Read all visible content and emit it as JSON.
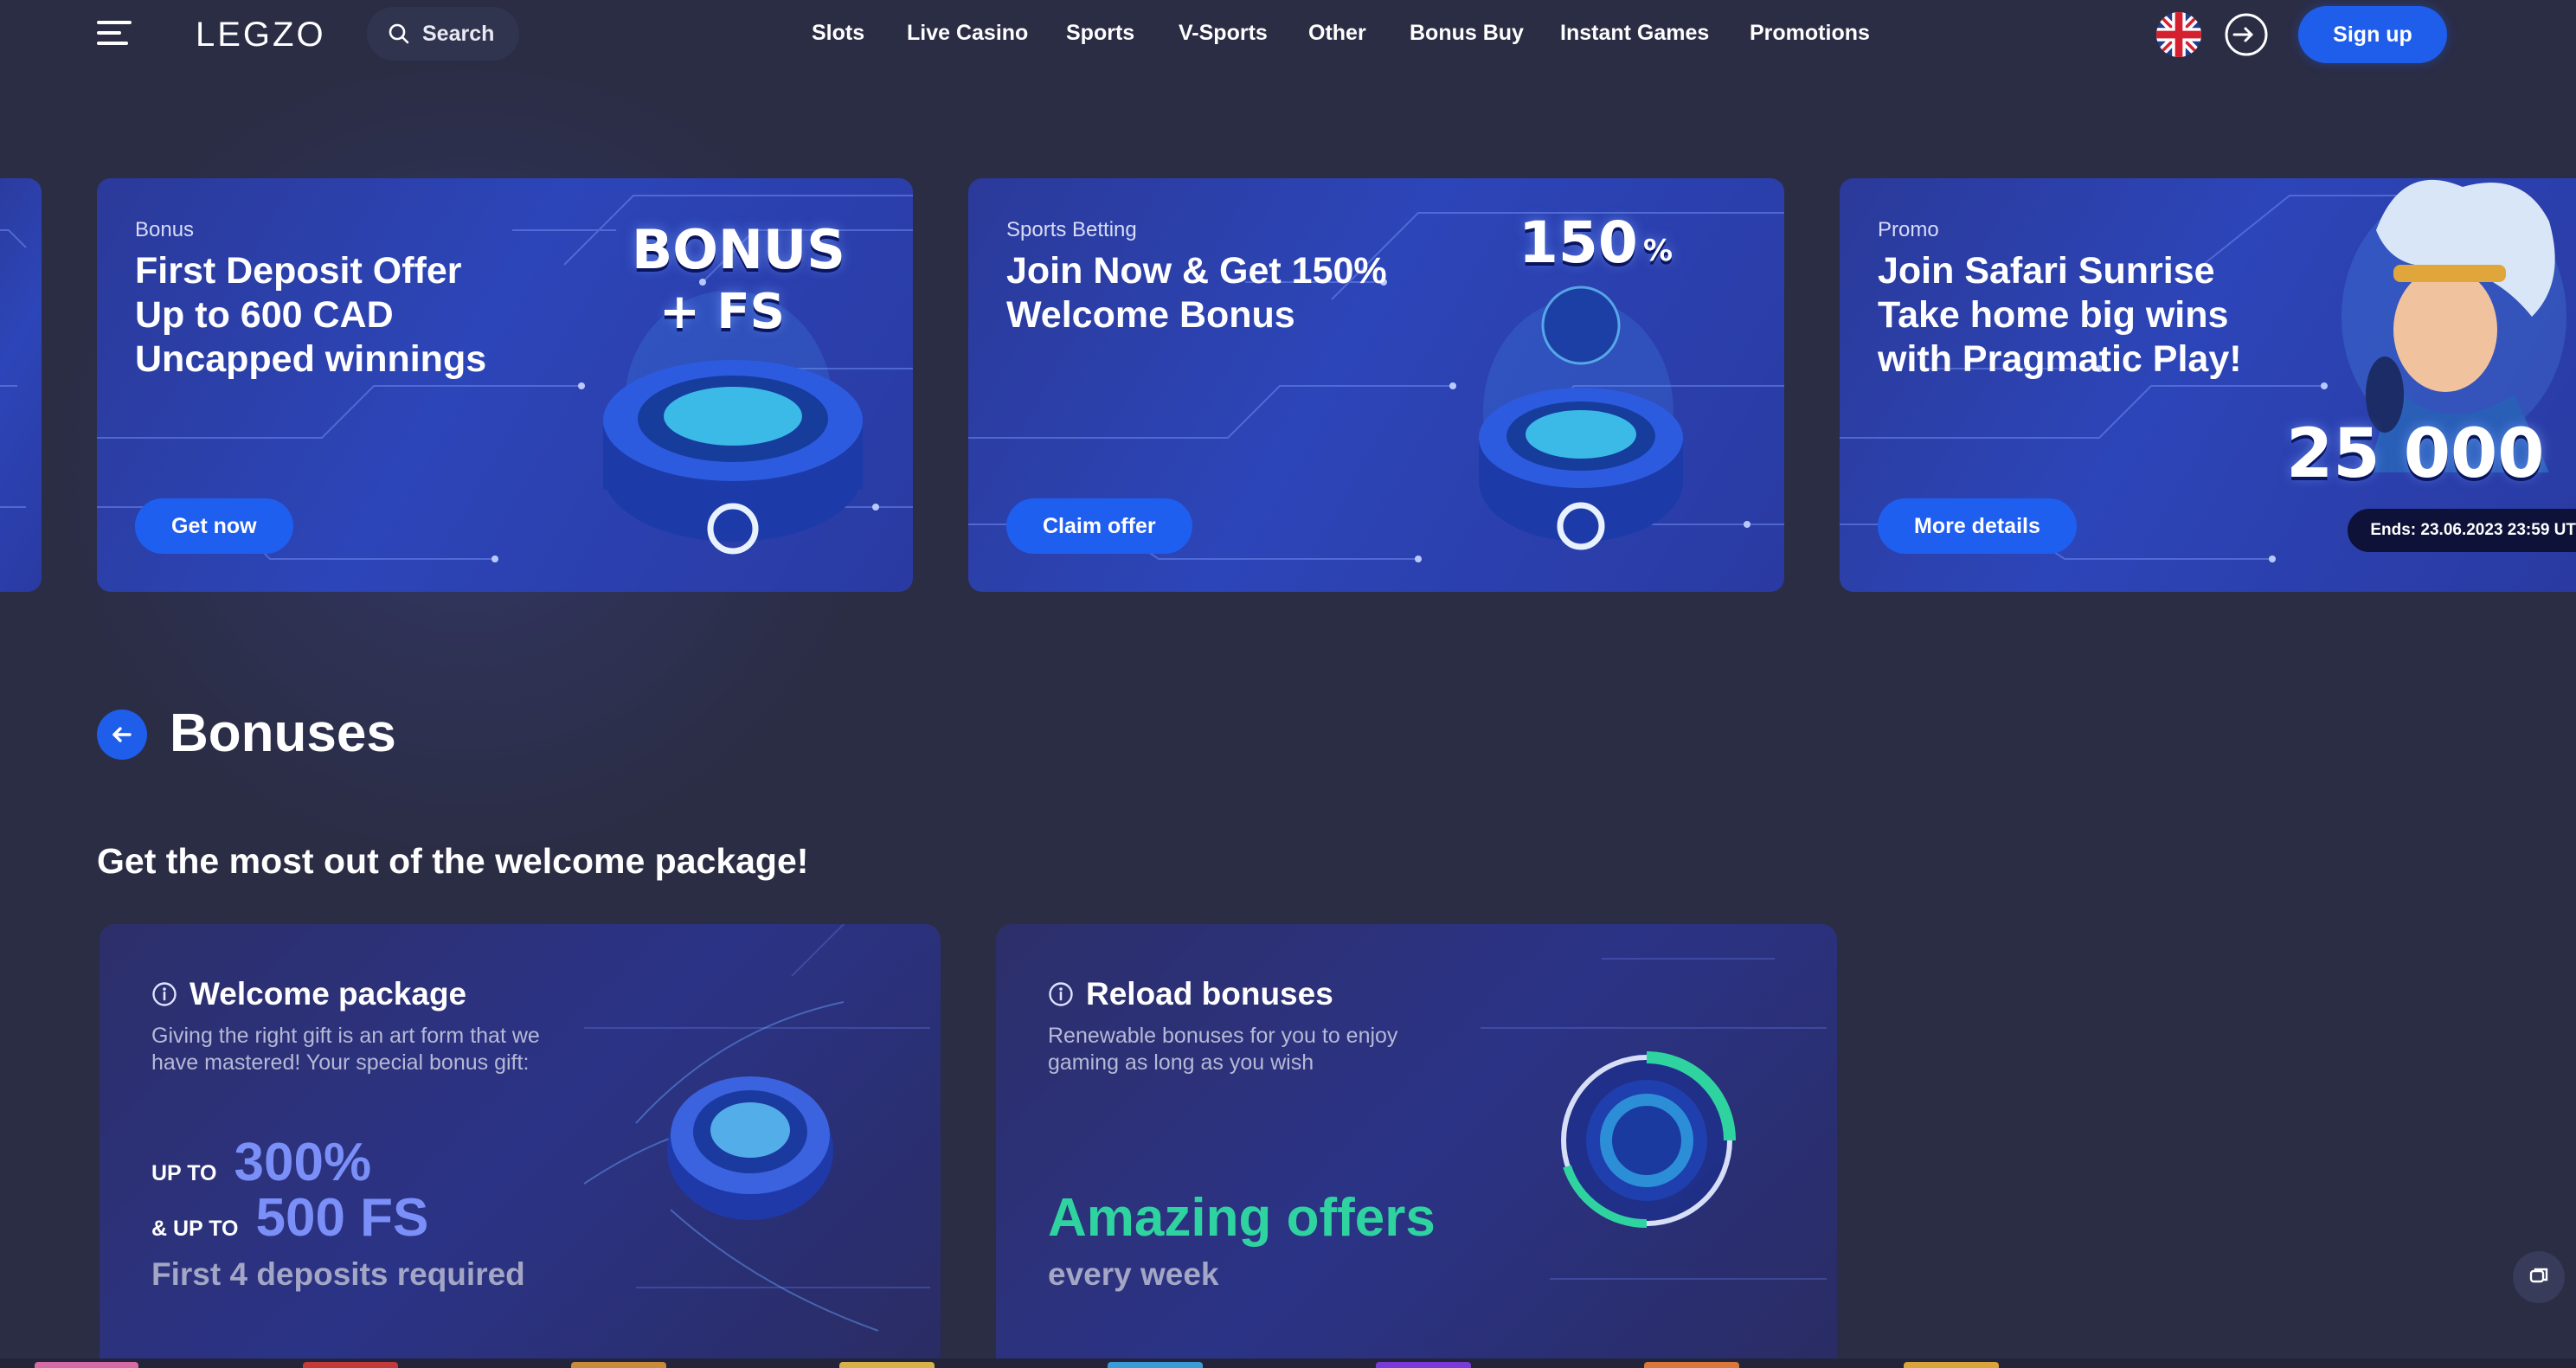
{
  "header": {
    "logo": "LEGZO",
    "search_label": "Search",
    "nav": [
      "Slots",
      "Live Casino",
      "Sports",
      "V-Sports",
      "Other",
      "Bonus Buy",
      "Instant Games",
      "Promotions"
    ],
    "signup_label": "Sign up"
  },
  "promos": [
    {
      "category": "Bonus",
      "title": "First Deposit Offer\nUp to 600 CAD\nUncapped winnings",
      "button": "Get now",
      "art_text_1": "BONUS",
      "art_text_2": "+ FS"
    },
    {
      "category": "Sports Betting",
      "title": "Join Now & Get 150%\nWelcome Bonus",
      "button": "Claim offer",
      "art_text_1": "150",
      "art_text_2": "%"
    },
    {
      "category": "Promo",
      "title": "Join Safari Sunrise\nTake home big wins\nwith Pragmatic Play!",
      "button": "More details",
      "art_text_1": "25 000",
      "ends": "Ends: 23.06.2023 23:59 UT"
    }
  ],
  "section": {
    "title": "Bonuses",
    "subtitle": "Get the most out of the welcome package!"
  },
  "cards": [
    {
      "title": "Welcome package",
      "description": "Giving the right gift is an art form that we have mastered! Your special bonus gift:",
      "line1_label": "UP TO",
      "line1_value": "300%",
      "line2_label": "& UP TO",
      "line2_value": "500 FS",
      "requirement": "First 4 deposits required"
    },
    {
      "title": "Reload bonuses",
      "description": "Renewable bonuses for you to enjoy gaming as long as you wish",
      "highlight": "Amazing offers",
      "highlight_sub": "every week"
    }
  ],
  "colors": {
    "background": "#2b2d45",
    "accent_blue": "#1e5eea",
    "accent_green": "#2fd3a0",
    "accent_violet": "#7a8ff7"
  },
  "icons": [
    "menu-icon",
    "search-icon",
    "uk-flag-icon",
    "login-icon",
    "back-arrow-icon",
    "info-icon",
    "chat-icon"
  ]
}
